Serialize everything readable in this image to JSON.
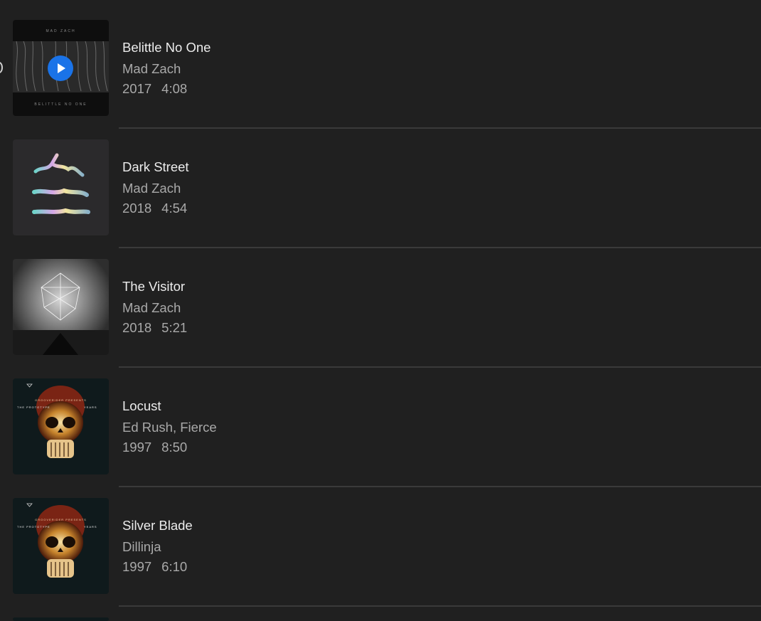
{
  "tracks": [
    {
      "title": "Belittle No One",
      "artist": "Mad Zach",
      "year": "2017",
      "duration": "4:08",
      "art": "belittle-no-one-cover"
    },
    {
      "title": "Dark Street",
      "artist": "Mad Zach",
      "year": "2018",
      "duration": "4:54",
      "art": "dark-street-cover"
    },
    {
      "title": "The Visitor",
      "artist": "Mad Zach",
      "year": "2018",
      "duration": "5:21",
      "art": "the-visitor-cover"
    },
    {
      "title": "Locust",
      "artist": "Ed Rush, Fierce",
      "year": "1997",
      "duration": "8:50",
      "art": "prototype-years-cover"
    },
    {
      "title": "Silver Blade",
      "artist": "Dillinja",
      "year": "1997",
      "duration": "6:10",
      "art": "prototype-years-cover"
    }
  ],
  "covers": {
    "belittle_top": "MAD ZACH",
    "belittle_bottom": "BELITTLE NO ONE",
    "prototype_top": "GROOVERIDER PRESENTS",
    "prototype_left": "THE PROTOTYPE",
    "prototype_right": "YEARS"
  },
  "colors": {
    "background": "#202020",
    "title": "#ececec",
    "secondary": "#a9a9a9",
    "divider": "#3a3a3a",
    "accent": "#1a73e8"
  },
  "icons": {
    "play": "play-icon"
  }
}
